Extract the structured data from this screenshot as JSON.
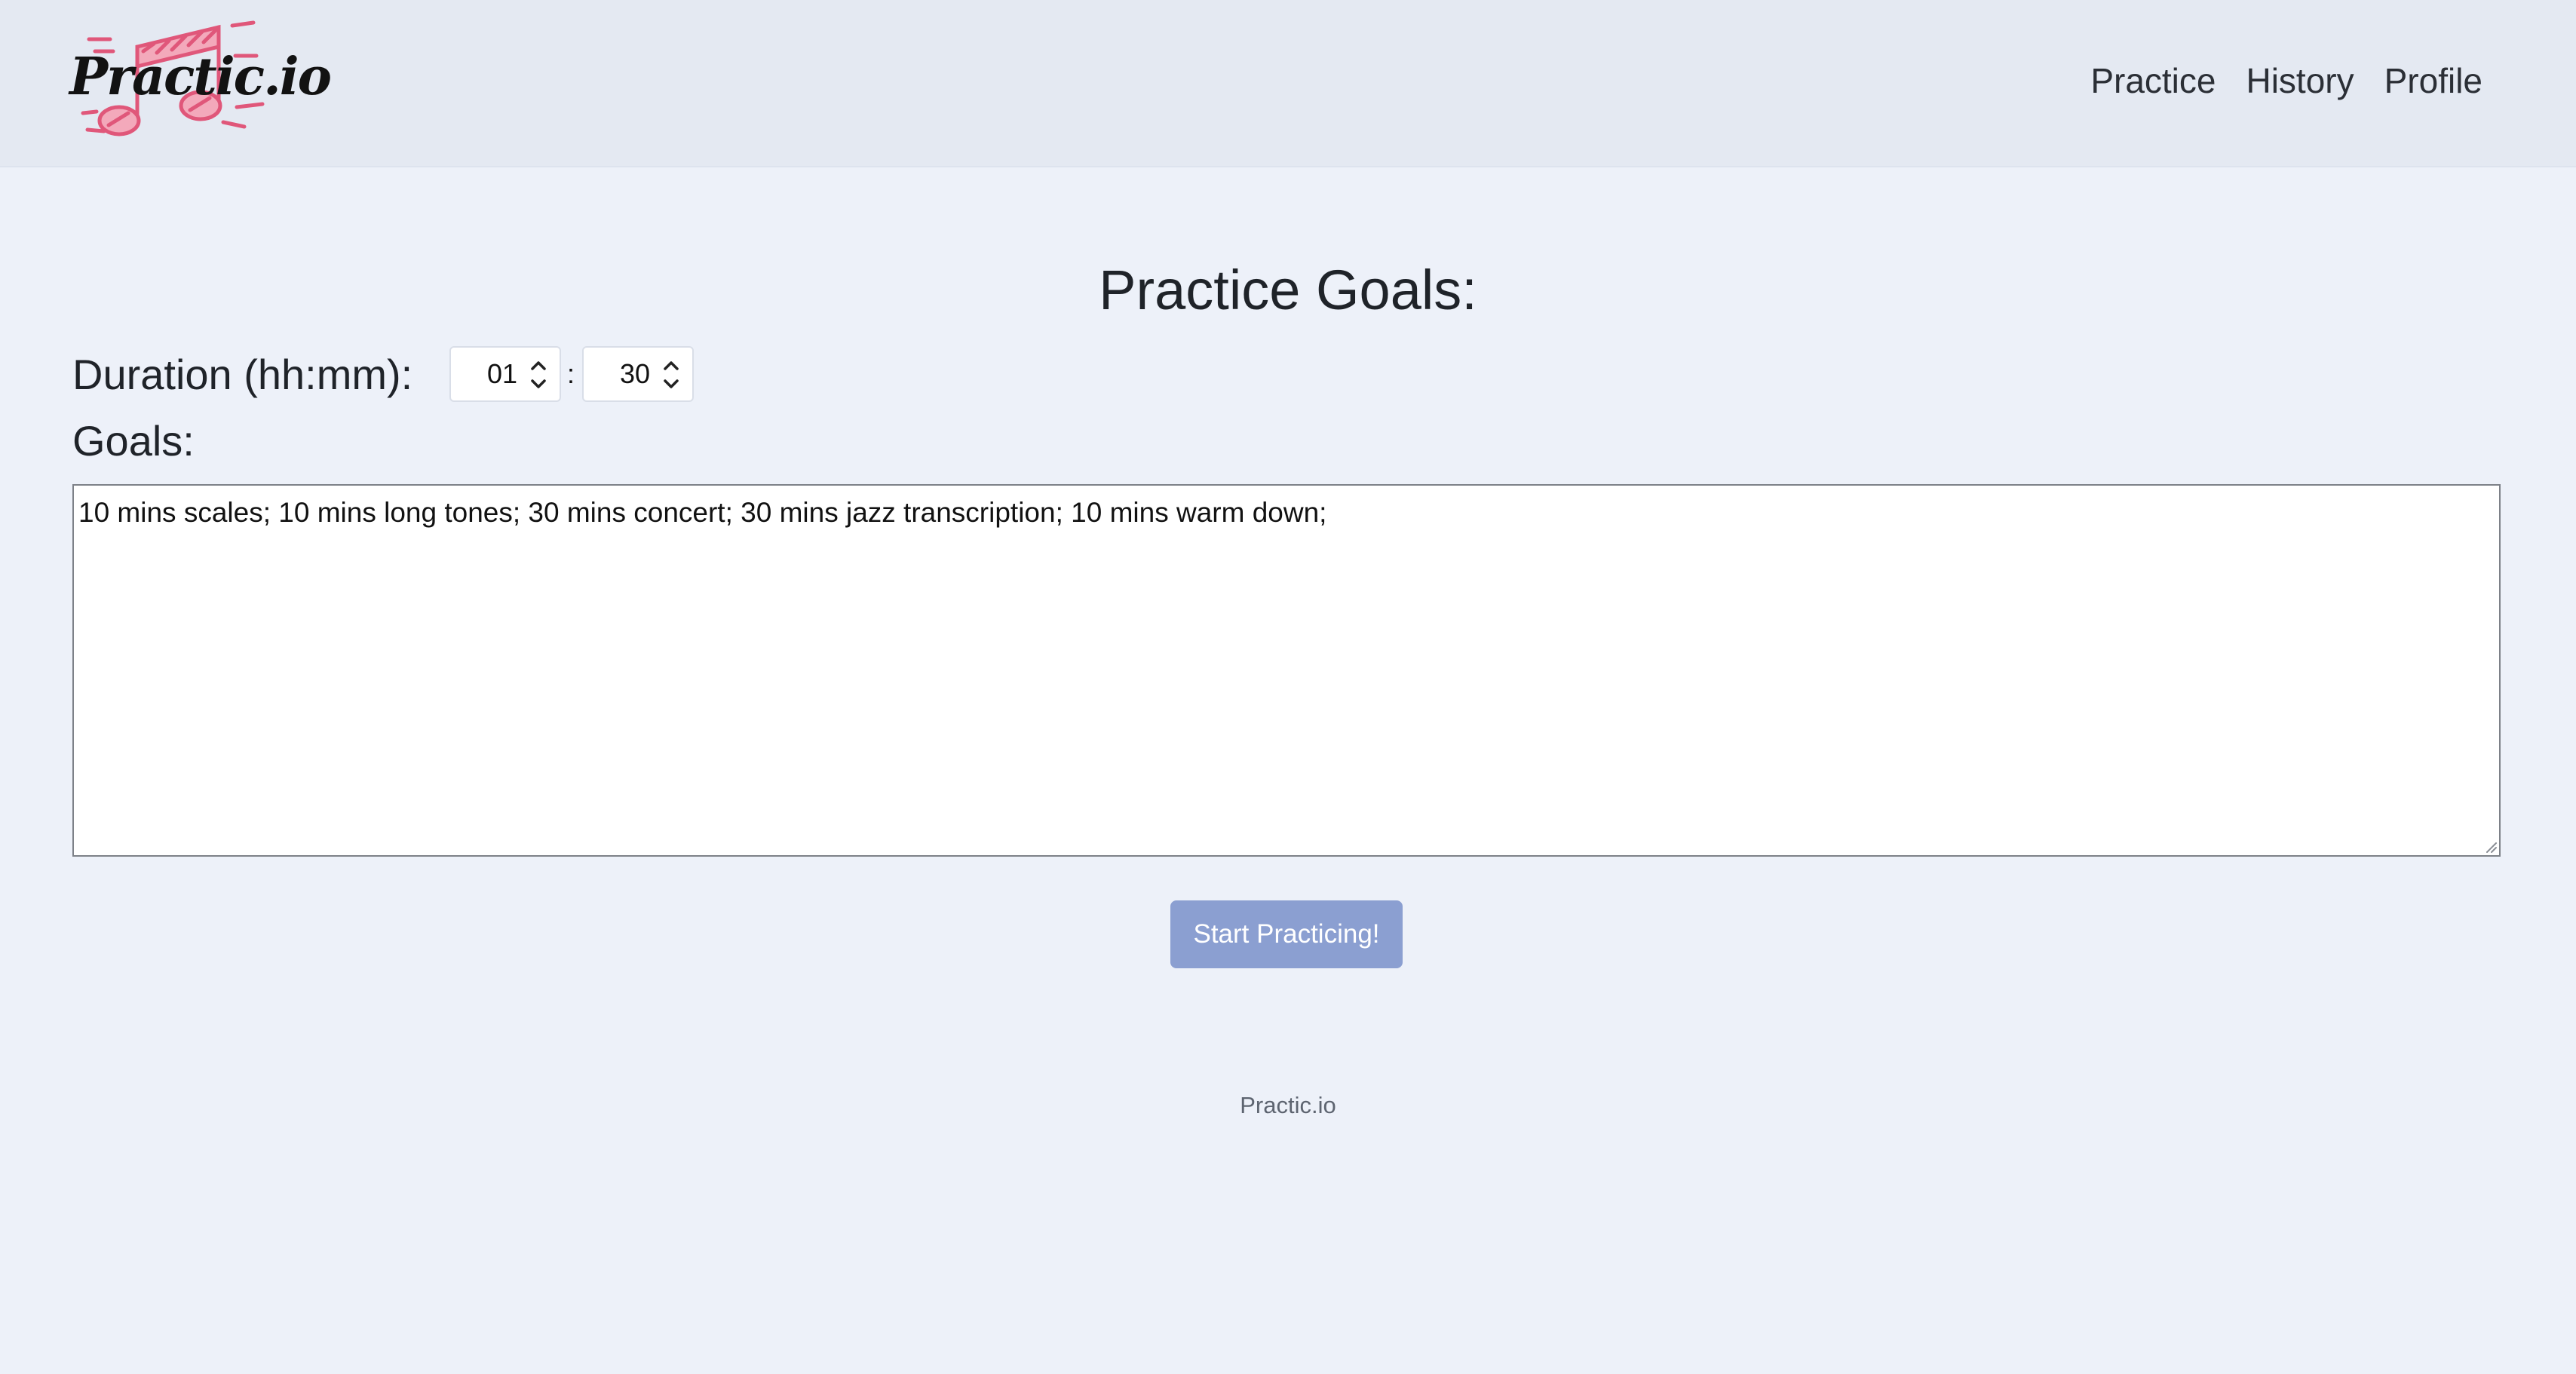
{
  "header": {
    "logo_text": "Practic.io",
    "logo_icon": "music-note-icon",
    "nav": [
      {
        "label": "Practice"
      },
      {
        "label": "History"
      },
      {
        "label": "Profile"
      }
    ]
  },
  "main": {
    "title": "Practice Goals:",
    "duration_label": "Duration (hh:mm):",
    "duration_hours": "01",
    "duration_separator": ":",
    "duration_minutes": "30",
    "goals_label": "Goals:",
    "goals_value": "10 mins scales; 10 mins long tones; 30 mins concert; 30 mins jazz transcription; 10 mins warm down;",
    "start_button": "Start Practicing!"
  },
  "footer": {
    "text": "Practic.io"
  },
  "colors": {
    "header_bg": "#e4e9f2",
    "page_bg": "#edf1f9",
    "button_bg": "#8b9fd1",
    "logo_accent": "#e0577a"
  }
}
